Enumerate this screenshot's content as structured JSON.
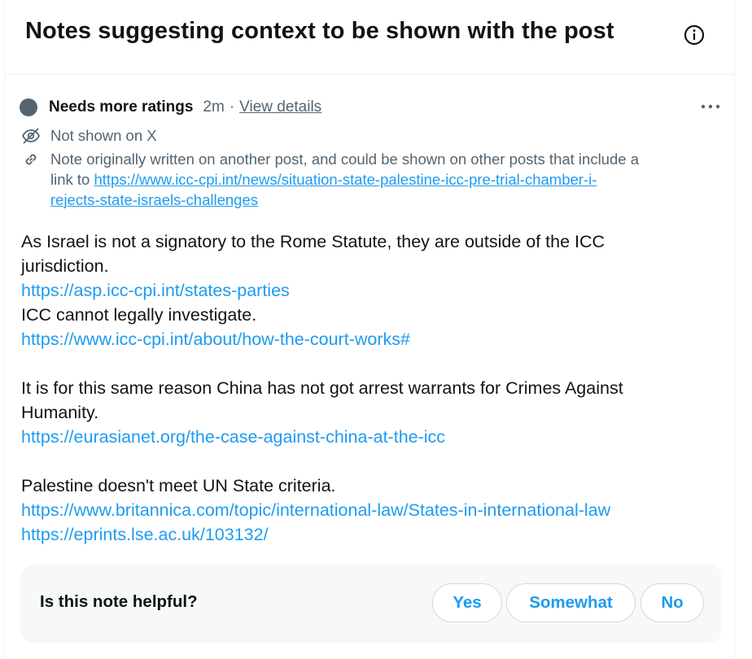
{
  "header": {
    "title": "Notes suggesting context to be shown with the post",
    "info_icon": "info-circle-icon"
  },
  "note": {
    "status": "Needs more ratings",
    "time": "2m",
    "separator": "·",
    "view_details": "View details",
    "more_icon": "more-horizontal-icon",
    "not_shown": "Not shown on X",
    "origin_text": "Note originally written on another post, and could be shown on other posts that include a",
    "origin_link_prefix": "link to",
    "origin_link_1": "https://www.icc-cpi.int/news/situation-state-palestine-icc-pre-trial-chamber-i-",
    "origin_link_2": "rejects-state-israels-challenges",
    "body": {
      "l1": "As Israel is not a signatory to the Rome Statute, they are outside of the ICC",
      "l2": "jurisdiction.",
      "link1": "https://asp.icc-cpi.int/states-parties",
      "l3": "ICC cannot legally investigate.",
      "link2": "https://www.icc-cpi.int/about/how-the-court-works#",
      "l4": "It is for this same reason China has not got arrest warrants for Crimes Against",
      "l5": "Humanity.",
      "link3": "https://eurasianet.org/the-case-against-china-at-the-icc",
      "l6": "Palestine doesn't meet UN State criteria.",
      "link4": "https://www.britannica.com/topic/international-law/States-in-international-law",
      "link5": "https://eprints.lse.ac.uk/103132/"
    }
  },
  "helpful": {
    "question": "Is this note helpful?",
    "yes": "Yes",
    "somewhat": "Somewhat",
    "no": "No"
  },
  "colors": {
    "accent": "#1d9bf0",
    "muted": "#536471",
    "text": "#0f1419",
    "panel": "#f7f9f9",
    "border": "#cfd9de"
  }
}
